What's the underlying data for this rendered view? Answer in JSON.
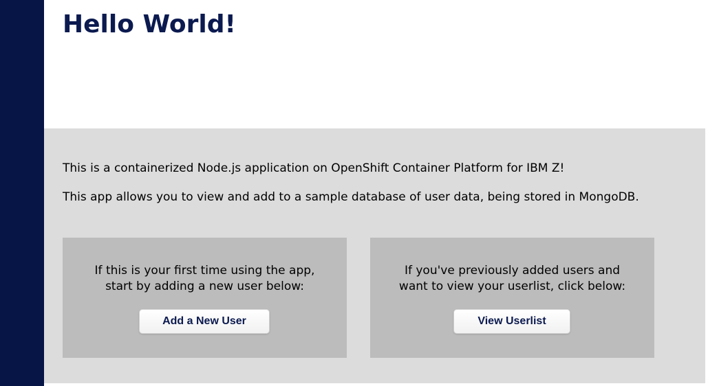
{
  "header": {
    "title": "Hello World!"
  },
  "intro": {
    "line1": "This is a containerized Node.js application on OpenShift Container Platform for IBM Z!",
    "line2": "This app allows you to view and add to a sample database of user data, being stored in MongoDB."
  },
  "cards": {
    "add_user": {
      "text_line1": "If this is your first time using the app,",
      "text_line2": "start by adding a new user below:",
      "button_label": "Add a New User"
    },
    "view_userlist": {
      "text_line1": "If you've previously added users and",
      "text_line2": "want to view your userlist, click below:",
      "button_label": "View Userlist"
    }
  },
  "colors": {
    "sidebar": "#061446",
    "title": "#0b1a4f",
    "content_bg": "#dcdcdc",
    "card_bg": "#bcbcbc"
  }
}
